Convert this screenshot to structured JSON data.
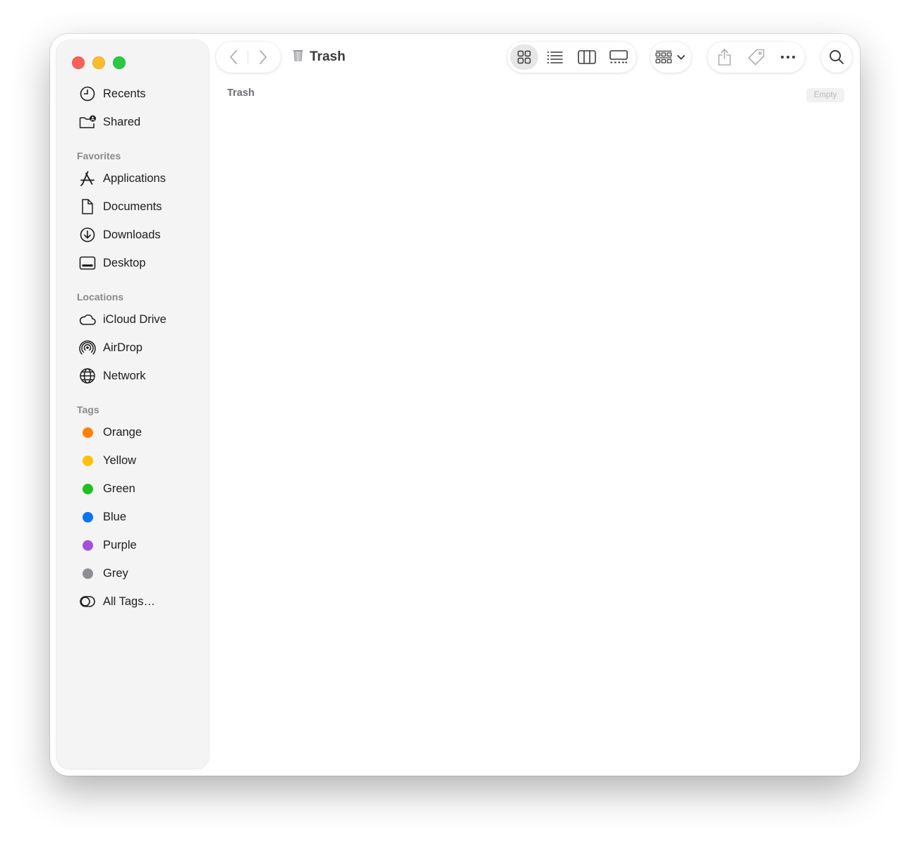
{
  "window": {
    "title": "Trash",
    "path_label": "Trash",
    "empty_button": "Empty"
  },
  "sidebar": {
    "top_items": [
      {
        "label": "Recents",
        "icon": "clock-icon"
      },
      {
        "label": "Shared",
        "icon": "shared-folder-icon"
      }
    ],
    "favorites_header": "Favorites",
    "favorites": [
      {
        "label": "Applications",
        "icon": "applications-icon"
      },
      {
        "label": "Documents",
        "icon": "document-icon"
      },
      {
        "label": "Downloads",
        "icon": "download-icon"
      },
      {
        "label": "Desktop",
        "icon": "desktop-icon"
      }
    ],
    "locations_header": "Locations",
    "locations": [
      {
        "label": "iCloud Drive",
        "icon": "cloud-icon"
      },
      {
        "label": "AirDrop",
        "icon": "airdrop-icon"
      },
      {
        "label": "Network",
        "icon": "globe-icon"
      }
    ],
    "tags_header": "Tags",
    "tags": [
      {
        "label": "Orange",
        "color": "#ff8000"
      },
      {
        "label": "Yellow",
        "color": "#ffc000"
      },
      {
        "label": "Green",
        "color": "#20c020"
      },
      {
        "label": "Blue",
        "color": "#0a74f5"
      },
      {
        "label": "Purple",
        "color": "#a550d9"
      },
      {
        "label": "Grey",
        "color": "#8e8e92"
      }
    ],
    "all_tags": {
      "label": "All Tags…",
      "icon": "all-tags-icon"
    }
  },
  "toolbar": {
    "view_mode_selected": "icon-view",
    "icons": [
      "back-arrow-icon",
      "forward-arrow-icon",
      "trash-icon",
      "icon-view-icon",
      "list-view-icon",
      "column-view-icon",
      "gallery-view-icon",
      "group-icon",
      "share-icon",
      "tag-icon",
      "more-icon",
      "search-icon"
    ]
  }
}
